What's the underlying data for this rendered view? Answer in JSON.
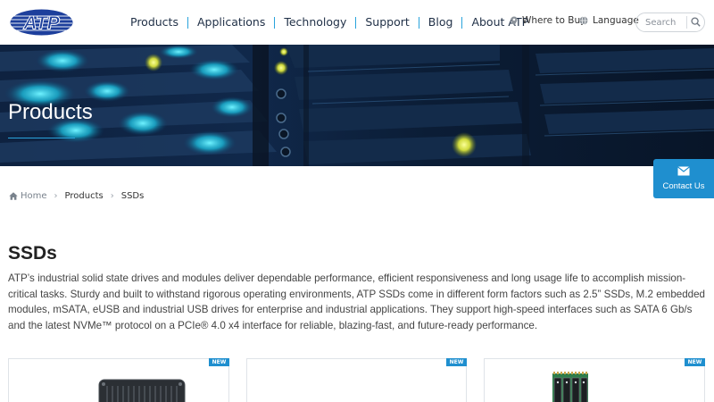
{
  "brand": {
    "logo_text": "ATP"
  },
  "nav": {
    "items": [
      {
        "label": "Products"
      },
      {
        "label": "Applications"
      },
      {
        "label": "Technology"
      },
      {
        "label": "Support"
      },
      {
        "label": "Blog"
      },
      {
        "label": "About ATP"
      }
    ]
  },
  "utility": {
    "where_to_buy": "Where to Buy",
    "language": "Language"
  },
  "search": {
    "placeholder": "Search"
  },
  "banner": {
    "title": "Products"
  },
  "contact": {
    "label": "Contact Us"
  },
  "breadcrumb": {
    "home": "Home",
    "items": [
      "Products",
      "SSDs"
    ]
  },
  "main": {
    "title": "SSDs",
    "description": "ATP’s industrial solid state drives and modules deliver dependable performance, efficient responsiveness and long usage life to accomplish mission-critical tasks. Sturdy and built to withstand rigorous operating environments, ATP SSDs come in different form factors such as 2.5” SSDs, M.2 embedded modules, mSATA, eUSB and industrial USB drives for enterprise and industrial applications. They support high-speed interfaces such as SATA 6 Gb/s and the latest NVMe™ protocol on a PCIe® 4.0 x4 interface for reliable, blazing-fast, and future-ready performance."
  },
  "cards": [
    {
      "badge": "NEW"
    },
    {
      "badge": "NEW"
    },
    {
      "badge": "NEW"
    }
  ],
  "colors": {
    "accent": "#1f8fcf",
    "nav_text": "#1f2f46",
    "divider": "#29a3dc"
  }
}
